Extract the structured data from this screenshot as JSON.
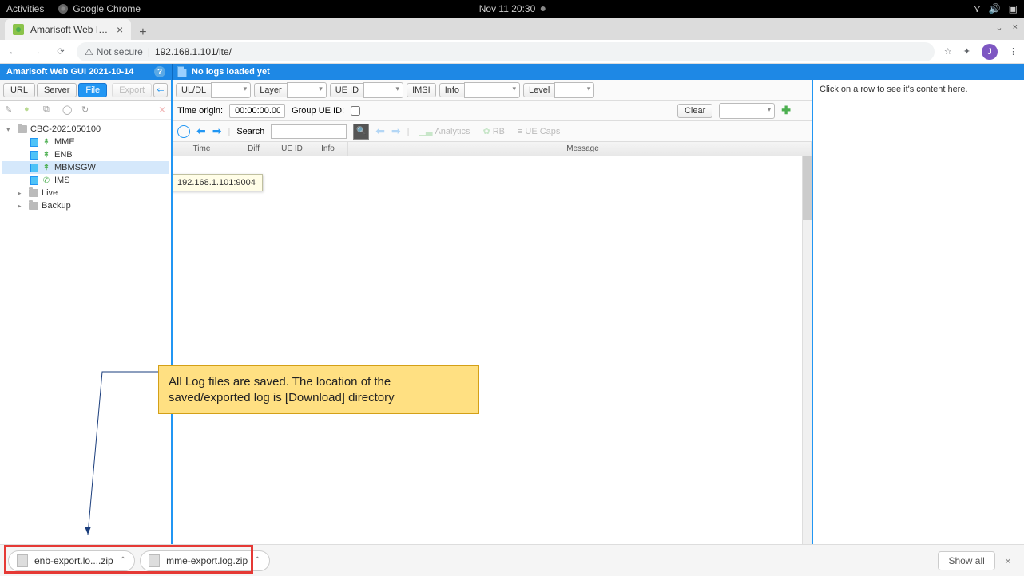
{
  "os": {
    "activities": "Activities",
    "app": "Google Chrome",
    "clock": "Nov 11  20:30"
  },
  "browser": {
    "tab_title": "Amarisoft Web Interface",
    "not_secure": "Not secure",
    "url": "192.168.1.101/lte/",
    "avatar_letter": "J"
  },
  "app": {
    "title": "Amarisoft Web GUI 2021-10-14",
    "no_logs": "No logs loaded yet"
  },
  "left_toolbar": {
    "url": "URL",
    "server": "Server",
    "file": "File",
    "export": "Export"
  },
  "tree": {
    "root": "CBC-2021050100",
    "mme": "MME",
    "enb": "ENB",
    "mbmsgw": "MBMSGW",
    "ims": "IMS",
    "live": "Live",
    "backup": "Backup"
  },
  "filters": {
    "uldl": "UL/DL",
    "layer": "Layer",
    "ueid": "UE ID",
    "imsi": "IMSI",
    "info": "Info",
    "level": "Level"
  },
  "origin": {
    "label": "Time origin:",
    "value": "00:00:00.000",
    "group": "Group UE ID:",
    "clear": "Clear"
  },
  "search": {
    "label": "Search",
    "analytics": "Analytics",
    "rb": "RB",
    "uecaps": "UE Caps"
  },
  "table": {
    "time": "Time",
    "diff": "Diff",
    "ueid": "UE ID",
    "info": "Info",
    "message": "Message"
  },
  "tooltip": "192.168.1.101:9004",
  "right_hint": "Click on a row to see it's content here.",
  "callout": "All Log files are saved. The location of the saved/exported log is [Download] directory",
  "downloads": {
    "file1": "enb-export.lo....zip",
    "file2": "mme-export.log.zip",
    "show_all": "Show all"
  }
}
